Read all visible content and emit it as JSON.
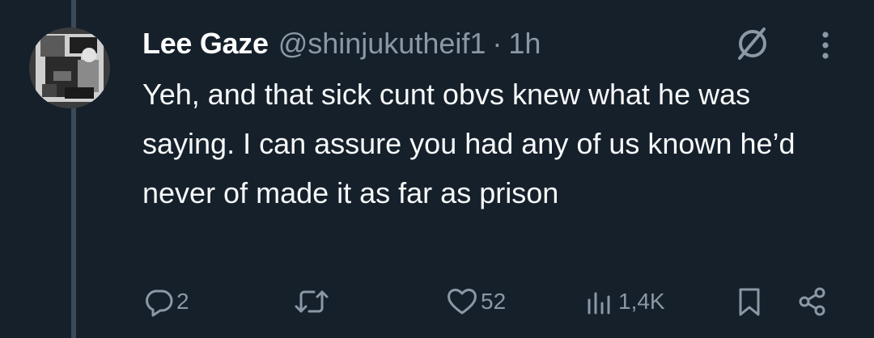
{
  "tweet": {
    "author_name": "Lee Gaze",
    "handle": "@shinjukutheif1",
    "separator": "·",
    "time": "1h",
    "text": "Yeh, and that sick cunt obvs knew what he was saying. I can assure you had any of us known he’d never of made it as far as prison",
    "avatar_icon": "profile-photo",
    "actions": {
      "replies": "2",
      "retweets": "",
      "likes": "52",
      "views": "1,4K"
    }
  },
  "colors": {
    "background": "#15202b",
    "thread_line": "#3b4a5a",
    "primary_text": "#f7f9f9",
    "secondary_text": "#8b98a5"
  }
}
